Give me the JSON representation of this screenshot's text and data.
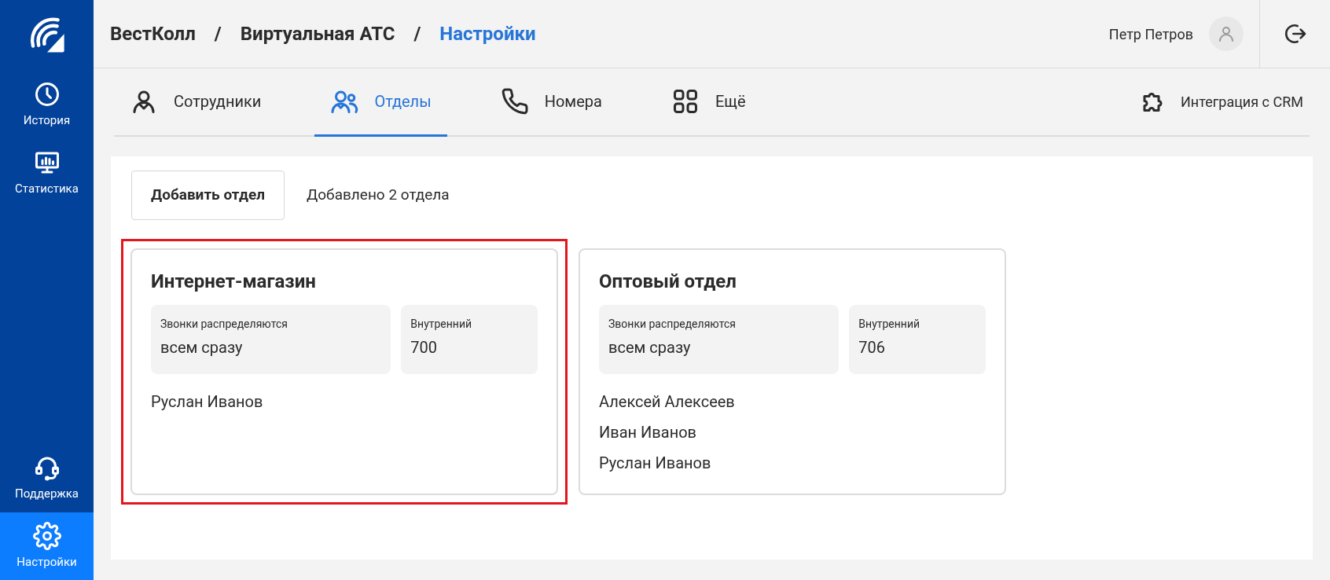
{
  "sidebar": {
    "top_items": [
      {
        "kind": "clock",
        "label": "История",
        "selected": false
      },
      {
        "kind": "chart",
        "label": "Статистика",
        "selected": false
      }
    ],
    "bottom_items": [
      {
        "kind": "headset",
        "label": "Поддержка",
        "selected": false
      },
      {
        "kind": "gear",
        "label": "Настройки",
        "selected": true
      }
    ]
  },
  "breadcrumbs": [
    {
      "label": "ВестКолл",
      "current": false
    },
    {
      "label": "Виртуальная АТС",
      "current": false
    },
    {
      "label": "Настройки",
      "current": true
    }
  ],
  "breadcrumb_separator": "/",
  "user": {
    "name": "Петр Петров"
  },
  "tabs": [
    {
      "kind": "person",
      "label": "Сотрудники",
      "selected": false
    },
    {
      "kind": "people",
      "label": "Отделы",
      "selected": true
    },
    {
      "kind": "phone",
      "label": "Номера",
      "selected": false
    },
    {
      "kind": "grid",
      "label": "Ещё",
      "selected": false
    }
  ],
  "integration_link": "Интеграция с CRM",
  "add_button": "Добавить отдел",
  "count_text": "Добавлено 2 отдела",
  "departments": [
    {
      "name": "Интернет-магазин",
      "highlighted": true,
      "distribution_label": "Звонки распределяются",
      "distribution_value": "всем сразу",
      "extension_label": "Внутренний",
      "extension_value": "700",
      "members": [
        "Руслан Иванов"
      ]
    },
    {
      "name": "Оптовый отдел",
      "highlighted": false,
      "distribution_label": "Звонки распределяются",
      "distribution_value": "всем сразу",
      "extension_label": "Внутренний",
      "extension_value": "706",
      "members": [
        "Алексей Алексеев",
        "Иван Иванов",
        "Руслан Иванов"
      ]
    }
  ]
}
